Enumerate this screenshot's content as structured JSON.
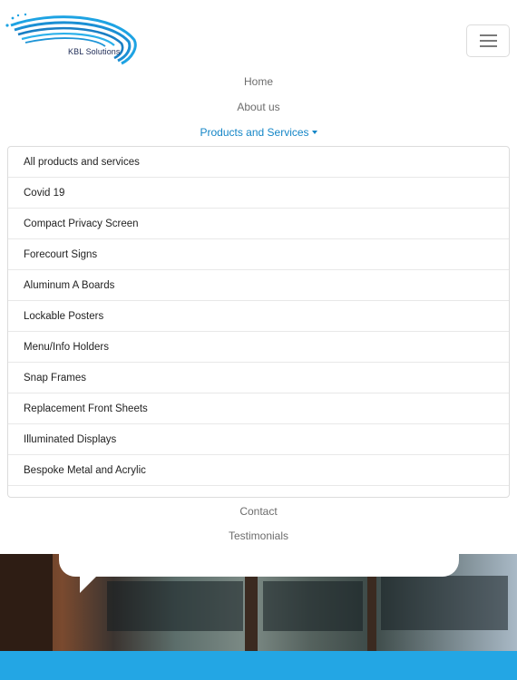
{
  "brand": {
    "logo_text": "KBL Solutions",
    "accent": "#1586c7"
  },
  "nav": {
    "home": "Home",
    "about": "About us",
    "products": "Products and Services",
    "contact": "Contact",
    "testimonials": "Testimonials"
  },
  "dropdown_items": [
    "All products and services",
    "Covid 19",
    "Compact Privacy Screen",
    "Forecourt Signs",
    "Aluminum A Boards",
    "Lockable Posters",
    "Menu/Info Holders",
    "Snap Frames",
    "Replacement Front Sheets",
    "Illuminated Displays",
    "Bespoke Metal and Acrylic"
  ],
  "colors": {
    "link_muted": "#6c6c6c",
    "band": "#23a6e4"
  },
  "icons": {
    "menu": "hamburger-icon",
    "dropdown": "caret-down-icon"
  }
}
